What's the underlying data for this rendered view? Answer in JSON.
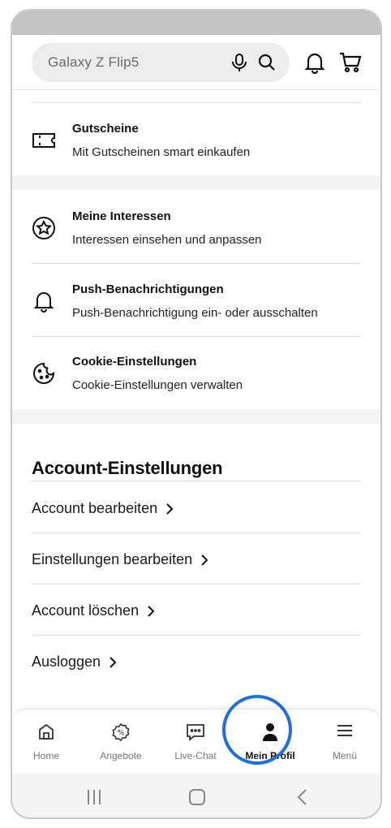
{
  "search": {
    "placeholder": "Galaxy Z Flip5"
  },
  "header_icons": [
    "mic-icon",
    "search-icon",
    "bell-icon",
    "cart-icon"
  ],
  "list_groups": [
    {
      "items": [
        {
          "icon": "ticket-icon",
          "title": "Gutscheine",
          "subtitle": "Mit Gutscheinen smart einkaufen"
        }
      ]
    },
    {
      "items": [
        {
          "icon": "star-circle-icon",
          "title": "Meine Interessen",
          "subtitle": "Interessen einsehen und anpassen"
        },
        {
          "icon": "bell-icon",
          "title": "Push-Benachrichtigungen",
          "subtitle": "Push-Benachrichtigung ein- oder ausschalten"
        },
        {
          "icon": "cookie-icon",
          "title": "Cookie-Einstellungen",
          "subtitle": "Cookie-Einstellungen verwalten"
        }
      ]
    }
  ],
  "account": {
    "heading": "Account-Einstellungen",
    "links": [
      "Account bearbeiten",
      "Einstellungen bearbeiten",
      "Account löschen",
      "Ausloggen"
    ]
  },
  "bottom_nav": [
    {
      "icon": "home-icon",
      "label": "Home",
      "active": false
    },
    {
      "icon": "offers-badge-icon",
      "label": "Angebote",
      "active": false
    },
    {
      "icon": "chat-icon",
      "label": "Live-Chat",
      "active": false
    },
    {
      "icon": "person-icon",
      "label": "Mein Profil",
      "active": true
    },
    {
      "icon": "menu-icon",
      "label": "Menü",
      "active": false
    }
  ],
  "colors": {
    "highlight": "#1f6fd6",
    "section_gap": "#f3f3f3",
    "search_bg": "#ececec"
  }
}
